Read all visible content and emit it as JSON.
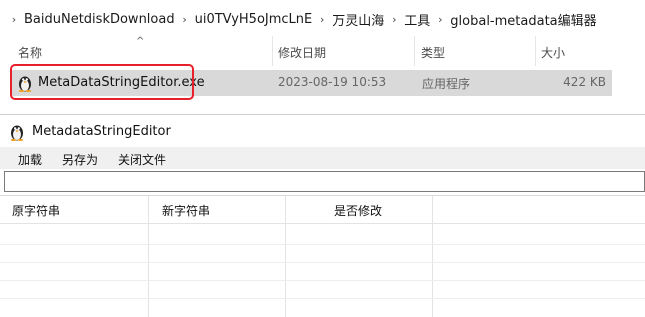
{
  "breadcrumb": [
    "BaiduNetdiskDownload",
    "ui0TVyH5oJmcLnE",
    "万灵山海",
    "工具",
    "global-metadata编辑器"
  ],
  "columns": {
    "name": "名称",
    "date": "修改日期",
    "type": "类型",
    "size": "大小"
  },
  "file": {
    "name": "MetaDataStringEditor.exe",
    "date": "2023-08-19 10:53",
    "type": "应用程序",
    "size": "422 KB",
    "icon": "tux-app-icon"
  },
  "highlight_color": "#e8202a",
  "app": {
    "title": "MetadataStringEditor",
    "menu": [
      "加载",
      "另存为",
      "关闭文件"
    ],
    "path_value": "",
    "grid_headers": [
      "原字符串",
      "新字符串",
      "是否修改"
    ]
  }
}
